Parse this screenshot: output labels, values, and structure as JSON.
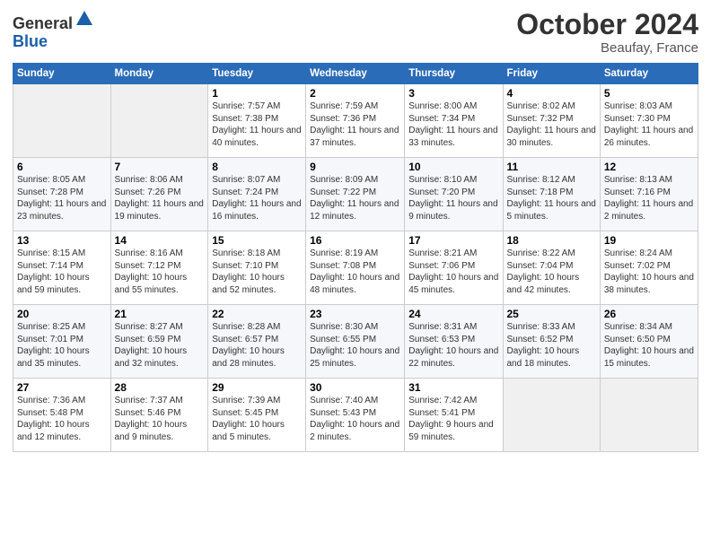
{
  "header": {
    "logo_line1": "General",
    "logo_line2": "Blue",
    "month_title": "October 2024",
    "location": "Beaufay, France"
  },
  "days_of_week": [
    "Sunday",
    "Monday",
    "Tuesday",
    "Wednesday",
    "Thursday",
    "Friday",
    "Saturday"
  ],
  "weeks": [
    [
      {
        "num": "",
        "sunrise": "",
        "sunset": "",
        "daylight": ""
      },
      {
        "num": "",
        "sunrise": "",
        "sunset": "",
        "daylight": ""
      },
      {
        "num": "1",
        "sunrise": "Sunrise: 7:57 AM",
        "sunset": "Sunset: 7:38 PM",
        "daylight": "Daylight: 11 hours and 40 minutes."
      },
      {
        "num": "2",
        "sunrise": "Sunrise: 7:59 AM",
        "sunset": "Sunset: 7:36 PM",
        "daylight": "Daylight: 11 hours and 37 minutes."
      },
      {
        "num": "3",
        "sunrise": "Sunrise: 8:00 AM",
        "sunset": "Sunset: 7:34 PM",
        "daylight": "Daylight: 11 hours and 33 minutes."
      },
      {
        "num": "4",
        "sunrise": "Sunrise: 8:02 AM",
        "sunset": "Sunset: 7:32 PM",
        "daylight": "Daylight: 11 hours and 30 minutes."
      },
      {
        "num": "5",
        "sunrise": "Sunrise: 8:03 AM",
        "sunset": "Sunset: 7:30 PM",
        "daylight": "Daylight: 11 hours and 26 minutes."
      }
    ],
    [
      {
        "num": "6",
        "sunrise": "Sunrise: 8:05 AM",
        "sunset": "Sunset: 7:28 PM",
        "daylight": "Daylight: 11 hours and 23 minutes."
      },
      {
        "num": "7",
        "sunrise": "Sunrise: 8:06 AM",
        "sunset": "Sunset: 7:26 PM",
        "daylight": "Daylight: 11 hours and 19 minutes."
      },
      {
        "num": "8",
        "sunrise": "Sunrise: 8:07 AM",
        "sunset": "Sunset: 7:24 PM",
        "daylight": "Daylight: 11 hours and 16 minutes."
      },
      {
        "num": "9",
        "sunrise": "Sunrise: 8:09 AM",
        "sunset": "Sunset: 7:22 PM",
        "daylight": "Daylight: 11 hours and 12 minutes."
      },
      {
        "num": "10",
        "sunrise": "Sunrise: 8:10 AM",
        "sunset": "Sunset: 7:20 PM",
        "daylight": "Daylight: 11 hours and 9 minutes."
      },
      {
        "num": "11",
        "sunrise": "Sunrise: 8:12 AM",
        "sunset": "Sunset: 7:18 PM",
        "daylight": "Daylight: 11 hours and 5 minutes."
      },
      {
        "num": "12",
        "sunrise": "Sunrise: 8:13 AM",
        "sunset": "Sunset: 7:16 PM",
        "daylight": "Daylight: 11 hours and 2 minutes."
      }
    ],
    [
      {
        "num": "13",
        "sunrise": "Sunrise: 8:15 AM",
        "sunset": "Sunset: 7:14 PM",
        "daylight": "Daylight: 10 hours and 59 minutes."
      },
      {
        "num": "14",
        "sunrise": "Sunrise: 8:16 AM",
        "sunset": "Sunset: 7:12 PM",
        "daylight": "Daylight: 10 hours and 55 minutes."
      },
      {
        "num": "15",
        "sunrise": "Sunrise: 8:18 AM",
        "sunset": "Sunset: 7:10 PM",
        "daylight": "Daylight: 10 hours and 52 minutes."
      },
      {
        "num": "16",
        "sunrise": "Sunrise: 8:19 AM",
        "sunset": "Sunset: 7:08 PM",
        "daylight": "Daylight: 10 hours and 48 minutes."
      },
      {
        "num": "17",
        "sunrise": "Sunrise: 8:21 AM",
        "sunset": "Sunset: 7:06 PM",
        "daylight": "Daylight: 10 hours and 45 minutes."
      },
      {
        "num": "18",
        "sunrise": "Sunrise: 8:22 AM",
        "sunset": "Sunset: 7:04 PM",
        "daylight": "Daylight: 10 hours and 42 minutes."
      },
      {
        "num": "19",
        "sunrise": "Sunrise: 8:24 AM",
        "sunset": "Sunset: 7:02 PM",
        "daylight": "Daylight: 10 hours and 38 minutes."
      }
    ],
    [
      {
        "num": "20",
        "sunrise": "Sunrise: 8:25 AM",
        "sunset": "Sunset: 7:01 PM",
        "daylight": "Daylight: 10 hours and 35 minutes."
      },
      {
        "num": "21",
        "sunrise": "Sunrise: 8:27 AM",
        "sunset": "Sunset: 6:59 PM",
        "daylight": "Daylight: 10 hours and 32 minutes."
      },
      {
        "num": "22",
        "sunrise": "Sunrise: 8:28 AM",
        "sunset": "Sunset: 6:57 PM",
        "daylight": "Daylight: 10 hours and 28 minutes."
      },
      {
        "num": "23",
        "sunrise": "Sunrise: 8:30 AM",
        "sunset": "Sunset: 6:55 PM",
        "daylight": "Daylight: 10 hours and 25 minutes."
      },
      {
        "num": "24",
        "sunrise": "Sunrise: 8:31 AM",
        "sunset": "Sunset: 6:53 PM",
        "daylight": "Daylight: 10 hours and 22 minutes."
      },
      {
        "num": "25",
        "sunrise": "Sunrise: 8:33 AM",
        "sunset": "Sunset: 6:52 PM",
        "daylight": "Daylight: 10 hours and 18 minutes."
      },
      {
        "num": "26",
        "sunrise": "Sunrise: 8:34 AM",
        "sunset": "Sunset: 6:50 PM",
        "daylight": "Daylight: 10 hours and 15 minutes."
      }
    ],
    [
      {
        "num": "27",
        "sunrise": "Sunrise: 7:36 AM",
        "sunset": "Sunset: 5:48 PM",
        "daylight": "Daylight: 10 hours and 12 minutes."
      },
      {
        "num": "28",
        "sunrise": "Sunrise: 7:37 AM",
        "sunset": "Sunset: 5:46 PM",
        "daylight": "Daylight: 10 hours and 9 minutes."
      },
      {
        "num": "29",
        "sunrise": "Sunrise: 7:39 AM",
        "sunset": "Sunset: 5:45 PM",
        "daylight": "Daylight: 10 hours and 5 minutes."
      },
      {
        "num": "30",
        "sunrise": "Sunrise: 7:40 AM",
        "sunset": "Sunset: 5:43 PM",
        "daylight": "Daylight: 10 hours and 2 minutes."
      },
      {
        "num": "31",
        "sunrise": "Sunrise: 7:42 AM",
        "sunset": "Sunset: 5:41 PM",
        "daylight": "Daylight: 9 hours and 59 minutes."
      },
      {
        "num": "",
        "sunrise": "",
        "sunset": "",
        "daylight": ""
      },
      {
        "num": "",
        "sunrise": "",
        "sunset": "",
        "daylight": ""
      }
    ]
  ]
}
